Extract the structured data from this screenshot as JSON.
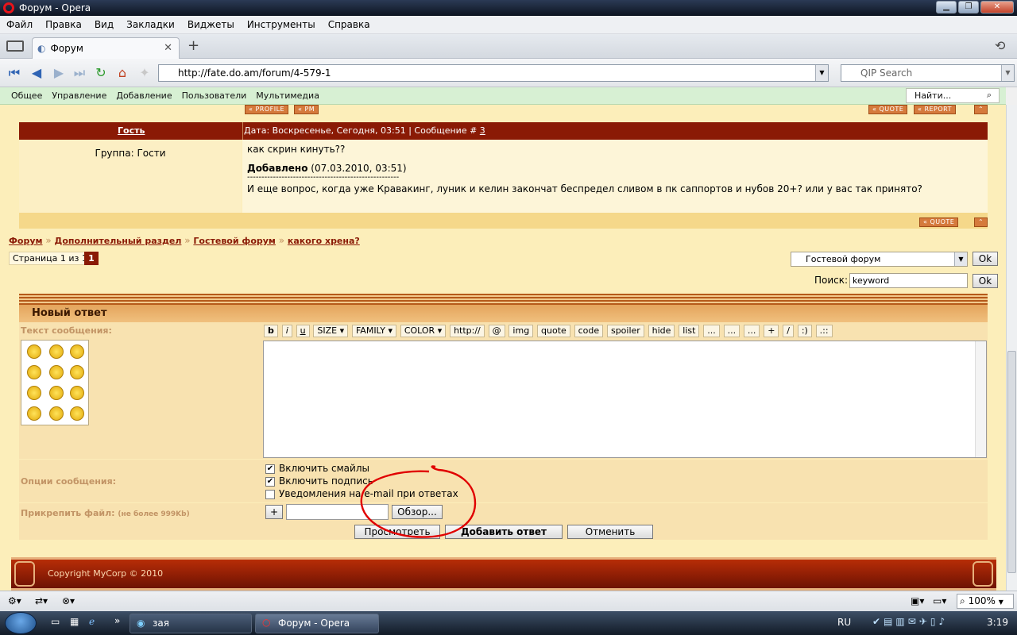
{
  "window": {
    "title": "Форум - Opera"
  },
  "menu": [
    "Файл",
    "Правка",
    "Вид",
    "Закладки",
    "Виджеты",
    "Инструменты",
    "Справка"
  ],
  "tab": {
    "title": "Форум"
  },
  "address": {
    "url": "http://fate.do.am/forum/4-579-1",
    "search_placeholder": "QIP Search"
  },
  "sitenav": {
    "items": [
      "Общее",
      "Управление",
      "Добавление",
      "Пользователи",
      "Мультимедиа"
    ],
    "find_placeholder": "Найти..."
  },
  "post": {
    "top_buttons": {
      "profile": "PROFILE",
      "pm": "PM",
      "quote": "QUOTE",
      "report": "REPORT"
    },
    "author": "Гость",
    "meta_prefix": "Дата: Воскресенье, Сегодня, 03:51 | Сообщение # ",
    "meta_num": "3",
    "group": "Группа: Гости",
    "line1": "как скрин кинуть??",
    "added_label": "Добавлено",
    "added_date": "(07.03.2010, 03:51)",
    "separator": "-----------------------------------------------------",
    "line2": "И еще вопрос, когда уже Кравакинг, луник и келин закончат беспредел сливом в пк саппортов и нубов 20+? или у вас так принято?",
    "quote_btn": "QUOTE"
  },
  "breadcrumb": [
    "Форум",
    "Дополнительный раздел",
    "Гостевой форум",
    "какого хрена?"
  ],
  "breadcrumb_sep": "»",
  "pagination": {
    "label": "Страница 1 из 1",
    "current": "1"
  },
  "forum_select": {
    "value": "Гостевой форум",
    "ok": "Ok"
  },
  "search": {
    "label": "Поиск:",
    "value": "keyword",
    "ok": "Ok"
  },
  "reply": {
    "title": "Новый ответ",
    "text_label": "Текст сообщения:",
    "toolbar": [
      "b",
      "i",
      "u",
      "SIZE",
      "FAMILY",
      "COLOR",
      "http://",
      "@",
      "img",
      "quote",
      "code",
      "spoiler",
      "hide",
      "list",
      "...",
      "...",
      "...",
      "+",
      "/",
      ":)",
      ".::"
    ],
    "options_label": "Опции сообщения:",
    "options": [
      "Включить смайлы",
      "Включить подпись",
      "Уведомления на e-mail при ответах"
    ],
    "attach_label": "Прикрепить файл:",
    "attach_note": "(не более 999Kb)",
    "attach_add": "+",
    "browse": "Обзор...",
    "preview": "Просмотреть",
    "submit": "Добавить ответ",
    "cancel": "Отменить"
  },
  "footer": {
    "copyright": "Copyright MyCorp © 2010"
  },
  "statusbar": {
    "zoom": "100%"
  },
  "taskbar": {
    "task1": "зая",
    "task2": "Форум - Opera",
    "lang": "RU",
    "time": "3:19"
  },
  "colors": {
    "accent": "#8a1a05",
    "page_bg": "#fceeba",
    "annotation": "#e00000"
  }
}
